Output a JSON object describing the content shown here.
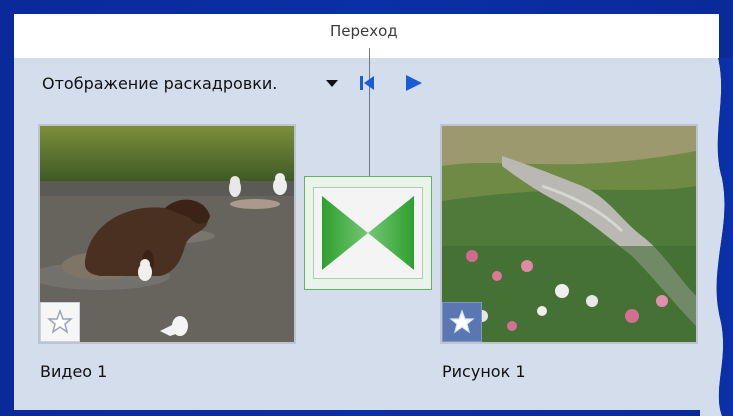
{
  "callout": {
    "label": "Переход"
  },
  "toolbar": {
    "view_label": "Отображение раскадровки.",
    "dropdown_icon": "chevron-down-icon",
    "rewind_icon": "skip-to-start-icon",
    "play_icon": "play-icon"
  },
  "clips": [
    {
      "caption": "Видео 1",
      "thumbnail": "bear-river-thumbnail",
      "star_icon": "star-icon"
    },
    {
      "caption": "Рисунок 1",
      "thumbnail": "stream-meadow-thumbnail",
      "star_icon": "star-icon"
    }
  ],
  "transition": {
    "icon": "bowtie-transition-icon"
  },
  "colors": {
    "background": "#0b2fa6",
    "panel": "#d3ddec",
    "accent_blue": "#1a5bd6",
    "transition_green": "#3aa43a"
  }
}
